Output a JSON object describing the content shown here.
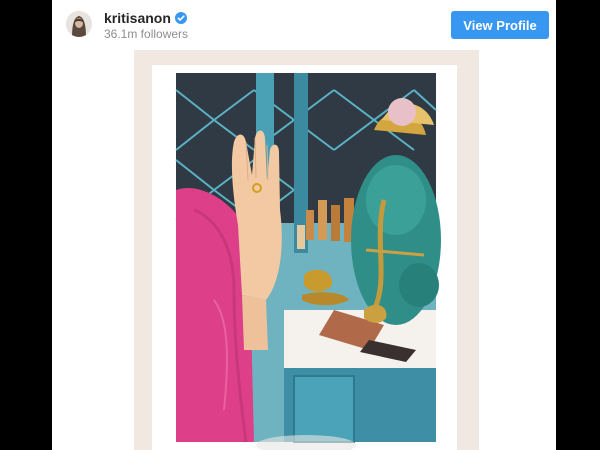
{
  "post": {
    "username": "kritisanon",
    "followers": "36.1m followers",
    "view_profile_label": "View Profile",
    "accent_color": "#3897f0",
    "verified_icon": "verified-badge-icon"
  }
}
